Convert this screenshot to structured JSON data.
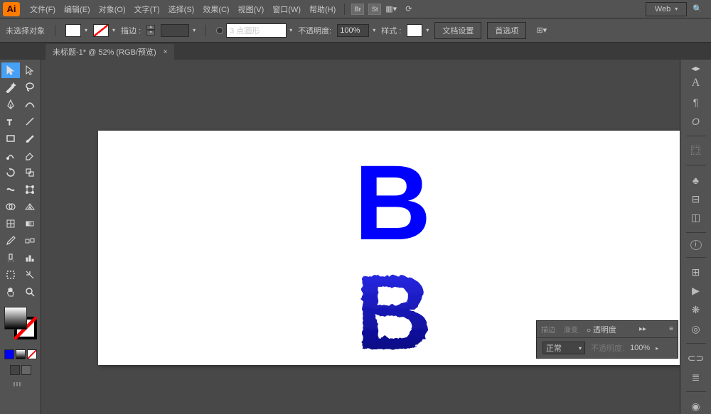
{
  "app_logo": "Ai",
  "menu": {
    "file": "文件(F)",
    "edit": "编辑(E)",
    "object": "对象(O)",
    "type": "文字(T)",
    "select": "选择(S)",
    "effect": "效果(C)",
    "view": "视图(V)",
    "window": "窗口(W)",
    "help": "帮助(H)"
  },
  "bridge_icon": "Br",
  "stock_icon": "St",
  "workspace": "Web",
  "options": {
    "no_selection": "未选择对象",
    "stroke_label": "描边 :",
    "stroke_value": "",
    "brush_value": "3 点圆形",
    "opacity_label": "不透明度:",
    "opacity_value": "100%",
    "style_label": "样式 :",
    "doc_setup": "文档设置",
    "preferences": "首选项"
  },
  "tab": {
    "title": "未标题-1* @ 52% (RGB/预览)"
  },
  "canvas": {
    "letter1": "B",
    "letter2": "B"
  },
  "transparency_panel": {
    "tab_stroke": "描边",
    "tab_gradient": "渐变",
    "tab_transparency": "透明度",
    "blend_mode": "正常",
    "opacity_label": "不透明度:",
    "opacity_value": "100%"
  }
}
